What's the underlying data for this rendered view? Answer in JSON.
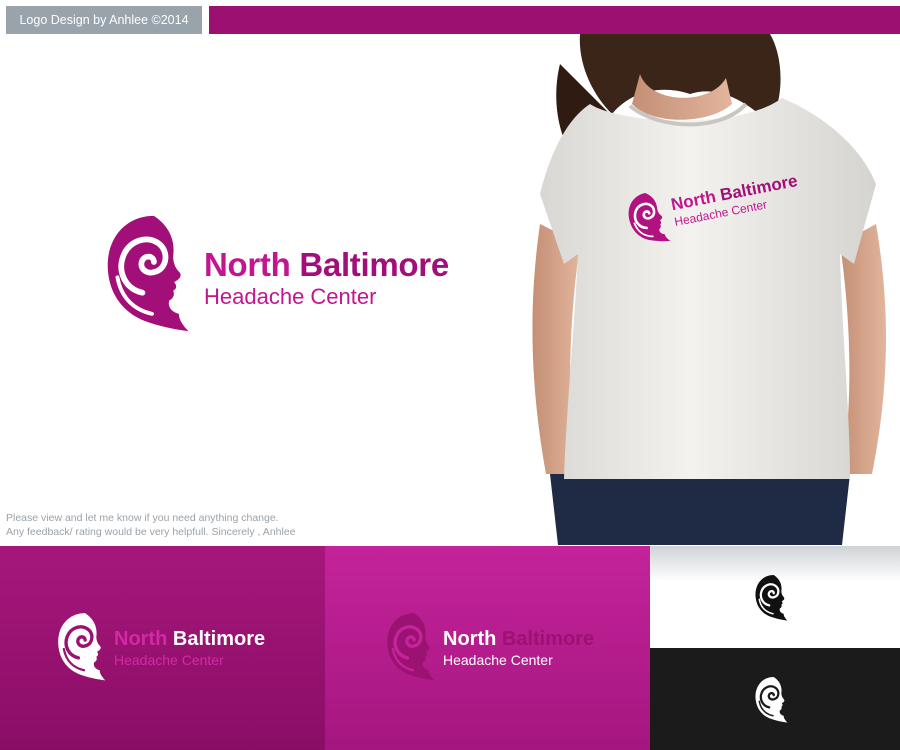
{
  "header": {
    "credit": "Logo Design by Anhlee ©2014"
  },
  "brand": {
    "word1": "North",
    "word2": "Baltimore",
    "subtitle": "Headache Center"
  },
  "note": {
    "line1": "Please view and let me know if you need anything change.",
    "line2": "Any feedback/ rating would be very helpfull. Sincerely , Anhlee"
  },
  "colors": {
    "magenta": "#c2158f",
    "deep_magenta": "#a30f78",
    "bar": "#9c1072",
    "badge_gray": "#99a3ab"
  },
  "icons": {
    "logo_mark": "woman-head-spiral-icon"
  }
}
